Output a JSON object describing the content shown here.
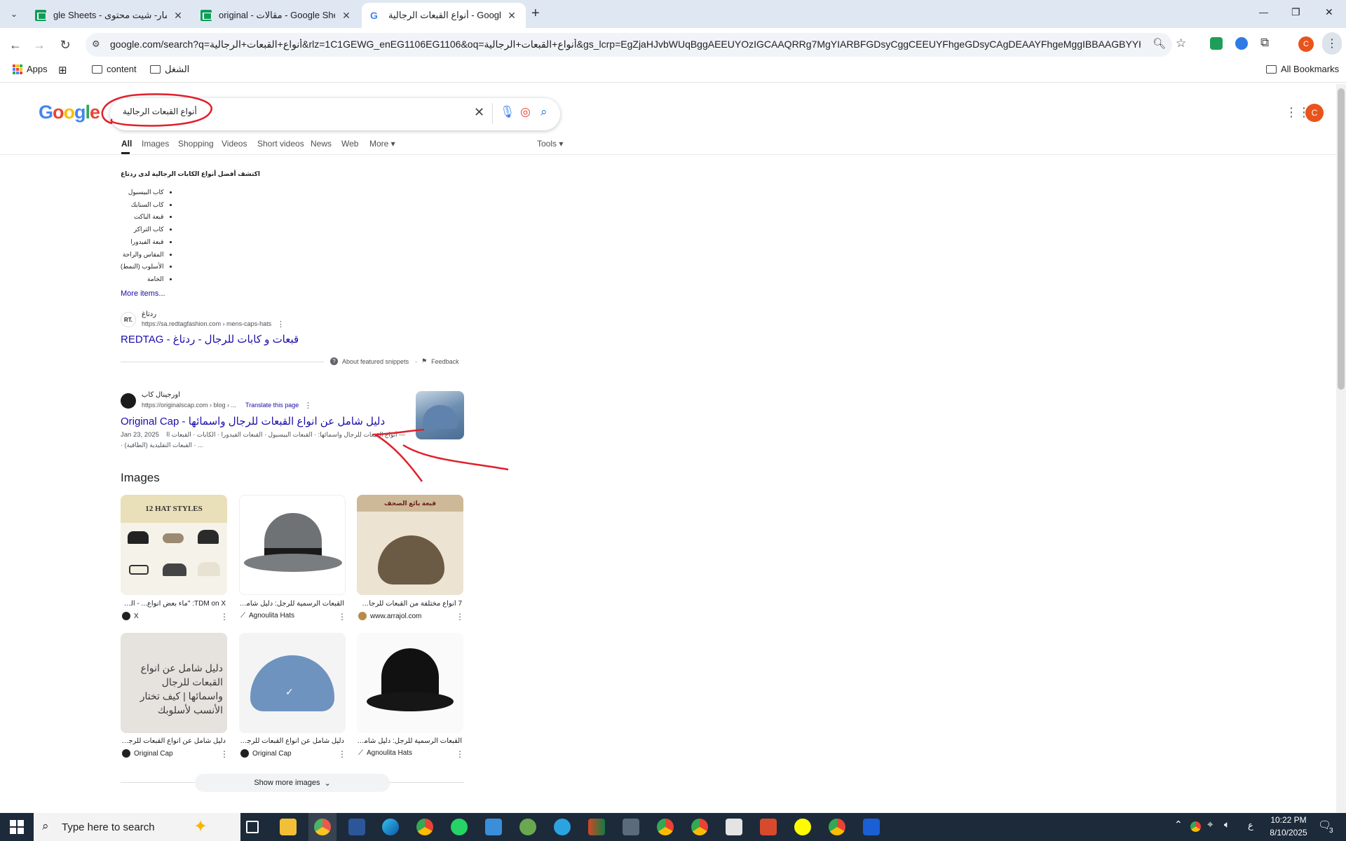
{
  "browser": {
    "tabs": [
      {
        "title": "عمار- شيت محتوى - Google Sheets",
        "visible_title": "gle Sheets - عمار- شيت محتوى",
        "favicon": "sheets-icon",
        "active": false
      },
      {
        "title": "original - مقالات - Google Sheets",
        "visible_title": "original - مقالات - Google Sheets",
        "favicon": "sheets-icon",
        "active": false
      },
      {
        "title": "أنواع القبعات الرجالية - Google Search",
        "visible_title": "أنواع القبعات الرجالية - Google Search",
        "favicon": "google-icon",
        "active": true
      }
    ],
    "new_tab": "+",
    "window_controls": {
      "minimize": "—",
      "restore": "❐",
      "close": "✕"
    },
    "url": "google.com/search?q=أنواع+القبعات+الرجالية&rlz=1C1GEWG_enEG1106EG1106&oq=أنواع+القبعات+الرجالية&gs_lcrp=EgZjaHJvbWUqBggAEEUYOzIGCAAQRRg7MgYIARBFGDsyCggCEEUYFhgeGDsyCAgDEAAYFhgeMggIBBAAGBYYHjIICAUQ...",
    "profile_letter": "C",
    "bookmarks": {
      "apps": "Apps",
      "content": "content",
      "work": "الشغل",
      "all": "All Bookmarks"
    }
  },
  "search": {
    "logo": "Google",
    "query": "أنواع القبعات الرجالية",
    "tabs": [
      "All",
      "Images",
      "Shopping",
      "Videos",
      "Short videos",
      "News",
      "Web",
      "More"
    ],
    "tools": "Tools",
    "profile_letter": "C"
  },
  "snippet": {
    "heading": "اكتشف أفضل أنواع الكابات الرجالية لدى ردتاغ",
    "items": [
      "كاب البيسبول",
      "كاب السنابك",
      "قبعة الباكت",
      "كاب التراكر",
      "قبعة الفيدورا",
      "المقاس والراحة",
      "الأسلوب (النمط)",
      "الخامة"
    ],
    "more": "More items...",
    "site_name": "ردتاغ",
    "site_url": "https://sa.redtagfashion.com › mens-caps-hats",
    "favicon_text": "RT.",
    "title": "قبعات و كابات للرجال - ردتاغ - REDTAG",
    "about": "About featured snippets",
    "feedback": "Feedback"
  },
  "result2": {
    "site_name": "اورجينال كاب",
    "site_url": "https://originalscap.com › blog › ...",
    "translate": "Translate this page",
    "title": "دليل شامل عن انواع القبعات للرجال واسمائها - Original Cap",
    "date": "Jan 23, 2025",
    "desc_line1": "— أنواع القبعات للرجال واسمائها: · القبعات البيسبول · القبعات الفيدورا · الكابات · القبعات الصوفية",
    "desc_line2": "... · القبعات التقليدية (الطاقية) ·"
  },
  "images": {
    "heading": "Images",
    "cards": [
      {
        "caption": "TDM on X: \"ماء بعض انواع... - الرجل",
        "source": "X",
        "overlay": "12 HAT STYLES"
      },
      {
        "caption": "القبعات الرسمية للرجل: دليل شامل للأناقة",
        "source": "Agnoulita Hats",
        "overlay": ""
      },
      {
        "caption": "7 أنواع مختلفة من القبعات للرجال | الرجل",
        "source": "www.arrajol.com",
        "overlay": "قبعة بائع الصحف"
      },
      {
        "caption": "دليل شامل عن انواع القبعات للرجال واسما...",
        "source": "Original Cap",
        "overlay": "دليل شامل عن انواع القبعات للرجال واسمائها | كيف تختار الأنسب لأسلوبك"
      },
      {
        "caption": "دليل شامل عن انواع القبعات للرجال واسما...",
        "source": "Original Cap",
        "overlay": ""
      },
      {
        "caption": "القبعات الرسمية للرجل: دليل شامل للأناقة",
        "source": "Agnoulita Hats",
        "overlay": ""
      }
    ],
    "show_more": "Show more images"
  },
  "taskbar": {
    "search_placeholder": "Type here to search",
    "time": "10:22 PM",
    "date": "8/10/2025",
    "lang": "ع",
    "notif_count": "3"
  },
  "colors": {
    "tabbar": "#dfe7f3",
    "link": "#1a0dab",
    "annotation": "#e0202a",
    "taskbar": "#1c2a3a"
  }
}
